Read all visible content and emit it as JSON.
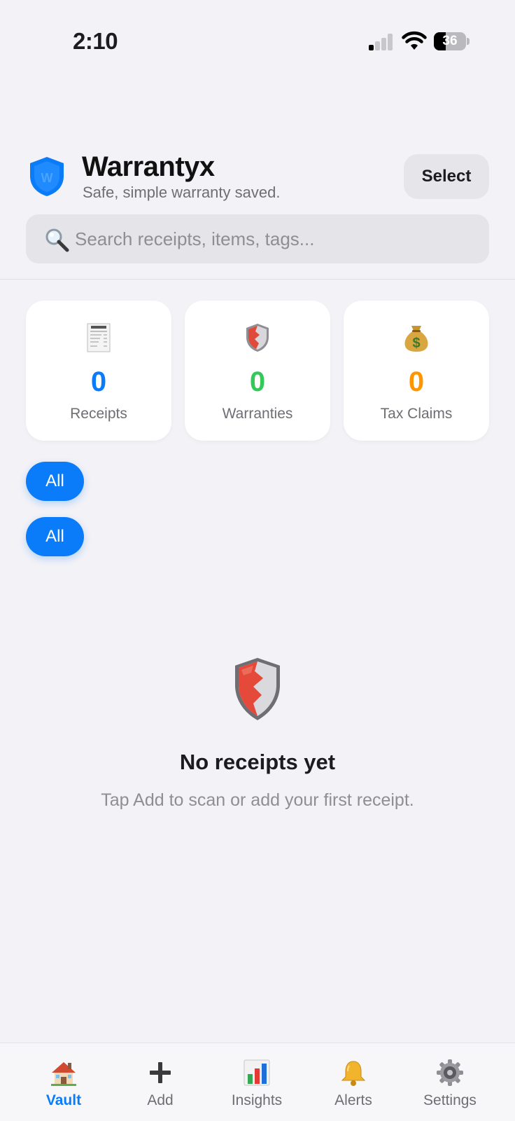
{
  "status_bar": {
    "time": "2:10",
    "battery": "36"
  },
  "header": {
    "title": "Warrantyx",
    "subtitle": "Safe, simple warranty saved.",
    "logo_letter": "W",
    "select_label": "Select"
  },
  "search": {
    "placeholder": "Search receipts, items, tags..."
  },
  "stats": [
    {
      "icon": "receipt-icon",
      "value": "0",
      "label": "Receipts",
      "color": "#0a7cf9"
    },
    {
      "icon": "shield-icon",
      "value": "0",
      "label": "Warranties",
      "color": "#34c759"
    },
    {
      "icon": "money-bag-icon",
      "value": "0",
      "label": "Tax Claims",
      "color": "#ff9500"
    }
  ],
  "filters": [
    {
      "label": "All"
    },
    {
      "label": "All"
    }
  ],
  "empty_state": {
    "icon": "shield-icon",
    "title": "No receipts yet",
    "message": "Tap Add to scan or add your first receipt."
  },
  "tabs": [
    {
      "icon": "house-icon",
      "label": "Vault",
      "active": true
    },
    {
      "icon": "plus-icon",
      "label": "Add",
      "active": false
    },
    {
      "icon": "bar-chart-icon",
      "label": "Insights",
      "active": false
    },
    {
      "icon": "bell-icon",
      "label": "Alerts",
      "active": false
    },
    {
      "icon": "gear-icon",
      "label": "Settings",
      "active": false
    }
  ],
  "colors": {
    "accent": "#0a7cf9",
    "background": "#f2f2f7"
  }
}
